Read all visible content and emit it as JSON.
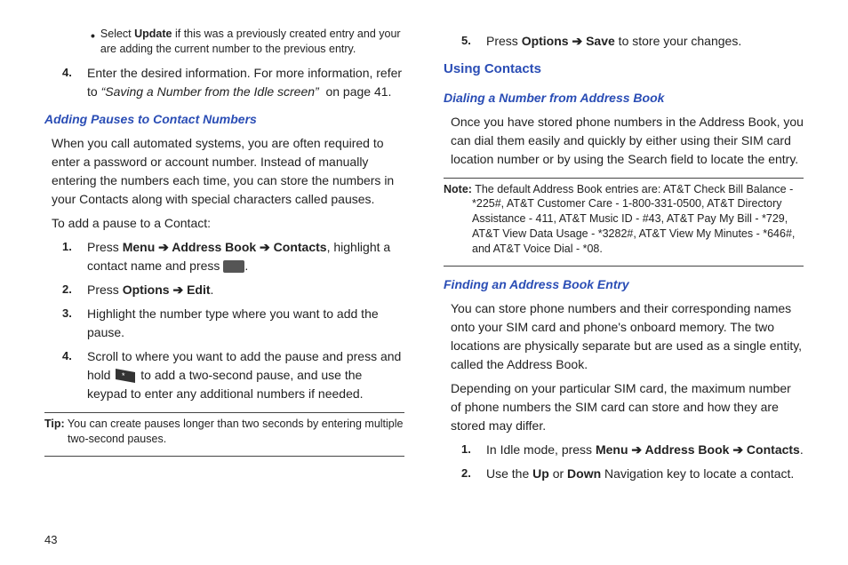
{
  "left": {
    "bullet1": "Select <b>Update</b> if this was a previously created entry and your are adding the current number to the previous entry.",
    "step4": "Enter the desired information. For more information, refer to <span class='ref-italic'>“Saving a Number from the Idle screen”</span>&nbsp; on page 41.",
    "sub1_title": "Adding Pauses to Contact Numbers",
    "sub1_p1": "When you call automated systems, you are often required to enter a password or account number. Instead of manually entering the numbers each time, you can store the numbers in your Contacts along with special characters called pauses.",
    "sub1_p2": "To add a pause to a Contact:",
    "s1": "Press <b>Menu <span class='arrow'>➔</span> Address Book <span class='arrow'>➔</span> Contacts</b>, highlight a contact name and press <span class='icon-key' data-name='ok-key-icon' data-interactable='false'></span>.",
    "s2": "Press <b>Options <span class='arrow'>➔</span> Edit</b>.",
    "s3": "Highlight the number type where you want to add the pause.",
    "s4": "Scroll to where you want to add the pause and press and hold <span class='icon-star' data-name='star-key-icon' data-interactable='false'><svg viewBox='0 0 26 18'><path d='M2 1 L24 5 L24 17 L2 13 Z' fill='#333'/><text x='9' y='12' font-size='9' fill='#fff'>*</text></svg></span> to add a two-second pause, and use the keypad to enter any additional numbers if needed.",
    "tip": "<b>Tip:</b> You can create pauses longer than two seconds by entering multiple <span class='tip-indent'>two-second pauses.</span>"
  },
  "right": {
    "step5": "Press <b>Options <span class='arrow'>➔</span> Save</b> to store your changes.",
    "sec_title": "Using Contacts",
    "sub1_title": "Dialing a Number from Address Book",
    "sub1_p1": "Once you have stored phone numbers in the Address Book, you can dial them easily and quickly by either using their SIM card location number or by using the Search field to locate the entry.",
    "note": "<b>Note:</b> The default Address Book entries are: AT&T Check Bill Balance - <span class='note-indent'>*225#, AT&T Customer Care - 1-800-331-0500, AT&T Directory Assistance - 411, AT&T Music ID - #43, AT&T Pay My Bill - *729, AT&T View Data Usage - *3282#, AT&T View My Minutes - *646#, and AT&T Voice Dial - *08.</span>",
    "sub2_title": "Finding an Address Book Entry",
    "sub2_p1": "You can store phone numbers and their corresponding names onto your SIM card and phone's onboard memory. The two locations are physically separate but are used as a single entity, called the Address Book.",
    "sub2_p2": "Depending on your particular SIM card, the maximum number of phone numbers the SIM card can store and how they are stored may differ.",
    "r1": "In Idle mode, press <b>Menu <span class='arrow'>➔</span> Address Book <span class='arrow'>➔</span> Contacts</b>.",
    "r2": "Use the <b>Up</b> or <b>Down</b> Navigation key to locate a contact."
  },
  "page_number": "43"
}
